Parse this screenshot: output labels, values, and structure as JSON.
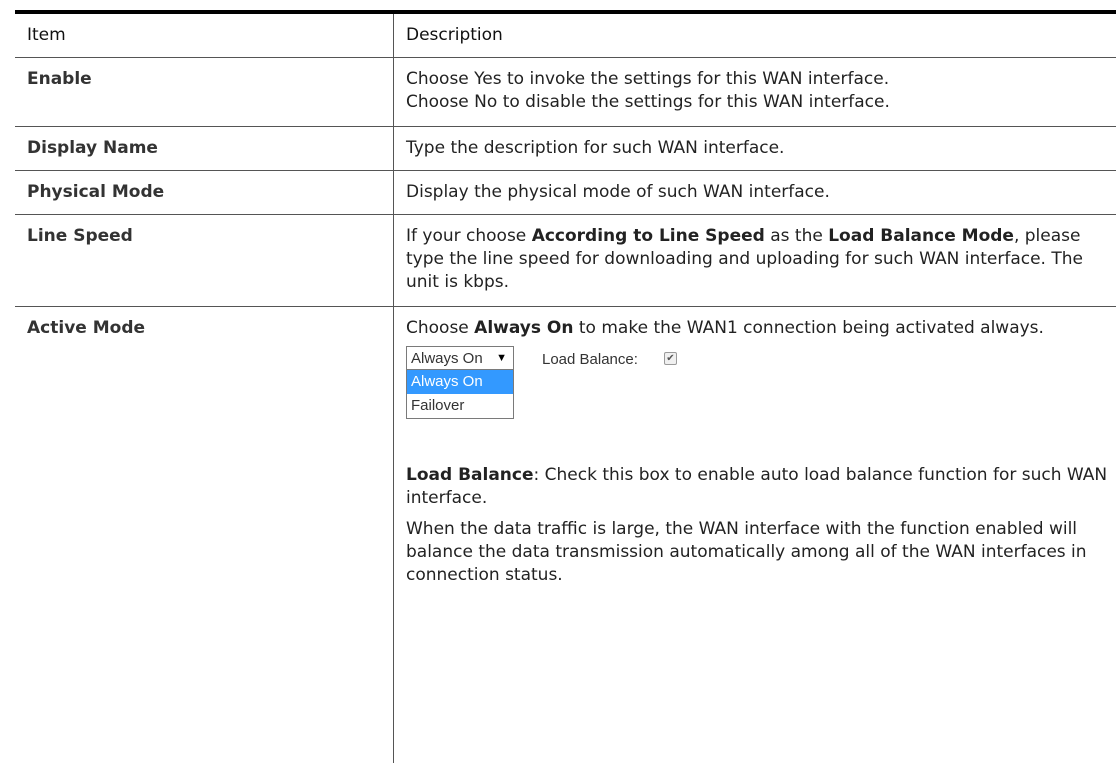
{
  "header": {
    "item": "Item",
    "description": "Description"
  },
  "rows": {
    "enable": {
      "item": "Enable",
      "desc_line1": "Choose Yes to invoke the settings for this WAN interface.",
      "desc_line2": "Choose No to disable the settings for this WAN interface."
    },
    "display_name": {
      "item": "Display Name",
      "desc": "Type the description for such WAN interface."
    },
    "physical_mode": {
      "item": "Physical Mode",
      "desc": "Display the physical mode of such WAN interface."
    },
    "line_speed": {
      "item": "Line Speed",
      "desc_pre": "If your choose ",
      "desc_bold1": "According to Line Speed",
      "desc_mid": " as the ",
      "desc_bold2": "Load Balance Mode",
      "desc_post": ", please type the line speed for downloading and uploading for such WAN interface. The unit is kbps."
    },
    "active_mode": {
      "item": "Active Mode",
      "desc_pre": "Choose ",
      "desc_bold": "Always On",
      "desc_post": " to make the WAN1 connection being activated always.",
      "lb_bold": "Load Balance",
      "lb_text": ": Check this box to enable auto load balance function for such WAN interface.",
      "traffic_text": "When the data traffic is large, the WAN interface with the function enabled will balance the data transmission automatically among all of the WAN interfaces in connection status."
    }
  },
  "widget": {
    "select_value": "Always On",
    "options": [
      "Always On",
      "Failover"
    ],
    "load_balance_label": "Load Balance:",
    "load_balance_checked": true
  }
}
